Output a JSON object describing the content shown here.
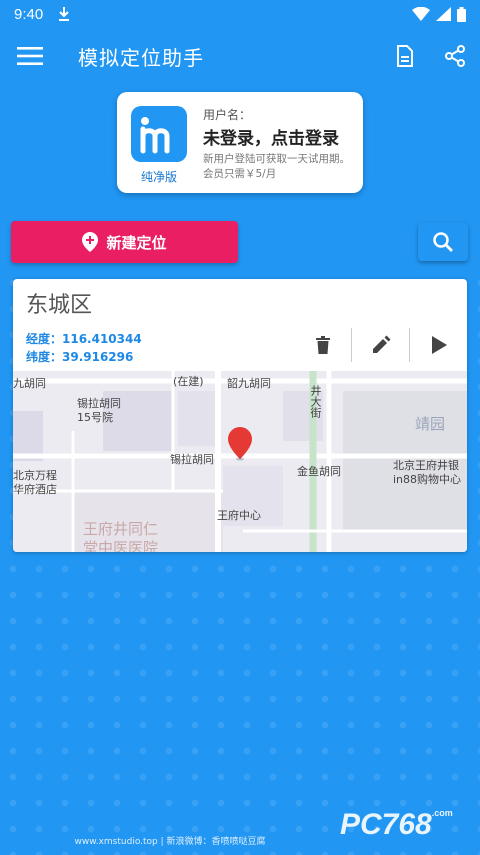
{
  "status_bar": {
    "time": "9:40"
  },
  "app_bar": {
    "title": "模拟定位助手"
  },
  "user_card": {
    "logo_caption": "纯净版",
    "label": "用户名：",
    "status": "未登录，点击登录",
    "note": "新用户登陆可获取一天试用期。会员只需￥5/月"
  },
  "new_location_button": {
    "label": "新建定位"
  },
  "location": {
    "name": "东城区",
    "longitude": "经度：116.410344",
    "latitude": "纬度：39.916296"
  },
  "map": {
    "labels": {
      "l1": "九胡同",
      "l2": "(在建)",
      "l3": "韶九胡同",
      "l4": "锡拉胡同",
      "l5": "15号院",
      "l6": "靖园",
      "l7": "北京万程",
      "l8": "华府酒店",
      "l9": "锡拉胡同",
      "l10": "金鱼胡同",
      "l11": "北京王府井银",
      "l12": "in88购物中心",
      "l13": "王府中心",
      "l14": "王府井同仁",
      "l15": "堂中医医院",
      "l16": "井大街"
    }
  },
  "footer": {
    "text": "www.xmstudio.top | 新浪微博：香喷喷哒豆腐"
  },
  "watermark": {
    "text": "PC768",
    "suffix": ".com"
  }
}
